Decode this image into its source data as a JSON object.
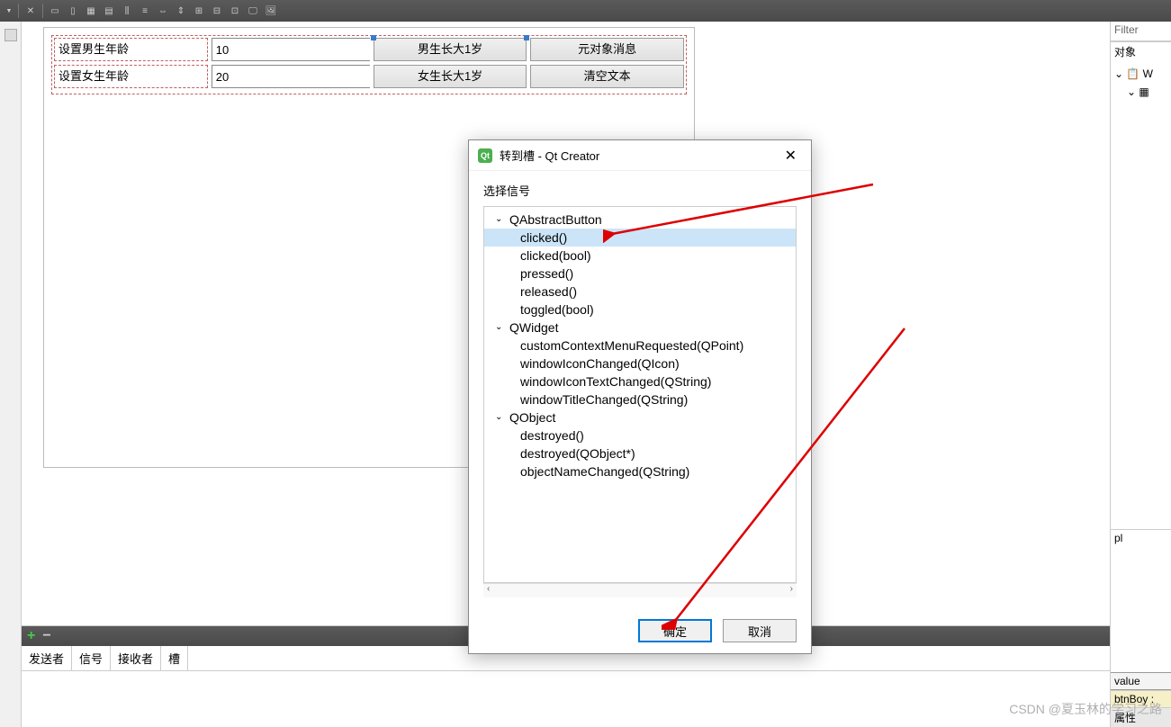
{
  "toolbar": {
    "icons": [
      "dd",
      "x",
      "layh",
      "layv",
      "layg",
      "layf",
      "cols",
      "rows",
      "hsp",
      "vsp",
      "grid1",
      "grid2",
      "grid3",
      "img1",
      "img2"
    ]
  },
  "form": {
    "rows": [
      {
        "label": "设置男生年龄",
        "spin_value": "10",
        "btn1": "男生长大1岁",
        "btn2": "元对象消息"
      },
      {
        "label": "设置女生年龄",
        "spin_value": "20",
        "btn1": "女生长大1岁",
        "btn2": "清空文本"
      }
    ]
  },
  "dialog": {
    "title": "转到槽 - Qt Creator",
    "select_label": "选择信号",
    "groups": [
      {
        "name": "QAbstractButton",
        "items": [
          "clicked()",
          "clicked(bool)",
          "pressed()",
          "released()",
          "toggled(bool)"
        ]
      },
      {
        "name": "QWidget",
        "items": [
          "customContextMenuRequested(QPoint)",
          "windowIconChanged(QIcon)",
          "windowIconTextChanged(QString)",
          "windowTitleChanged(QString)"
        ]
      },
      {
        "name": "QObject",
        "items": [
          "destroyed()",
          "destroyed(QObject*)",
          "objectNameChanged(QString)"
        ]
      }
    ],
    "selected": "clicked()",
    "ok": "确定",
    "cancel": "取消"
  },
  "right": {
    "filter": "Filter",
    "obj_header": "对象",
    "tree": [
      {
        "level": 0,
        "icon": "⌄",
        "icon2": "📋",
        "label": "W"
      },
      {
        "level": 1,
        "icon": "⌄",
        "icon2": "▦",
        "label": ""
      }
    ],
    "prop_pl": "pl",
    "value_label": "value",
    "obj_name": "btnBoy :",
    "prop_header": "属性"
  },
  "bottom": {
    "headers": [
      "发送者",
      "信号",
      "接收者",
      "槽"
    ]
  },
  "watermark": "CSDN @夏玉林的学习之路"
}
